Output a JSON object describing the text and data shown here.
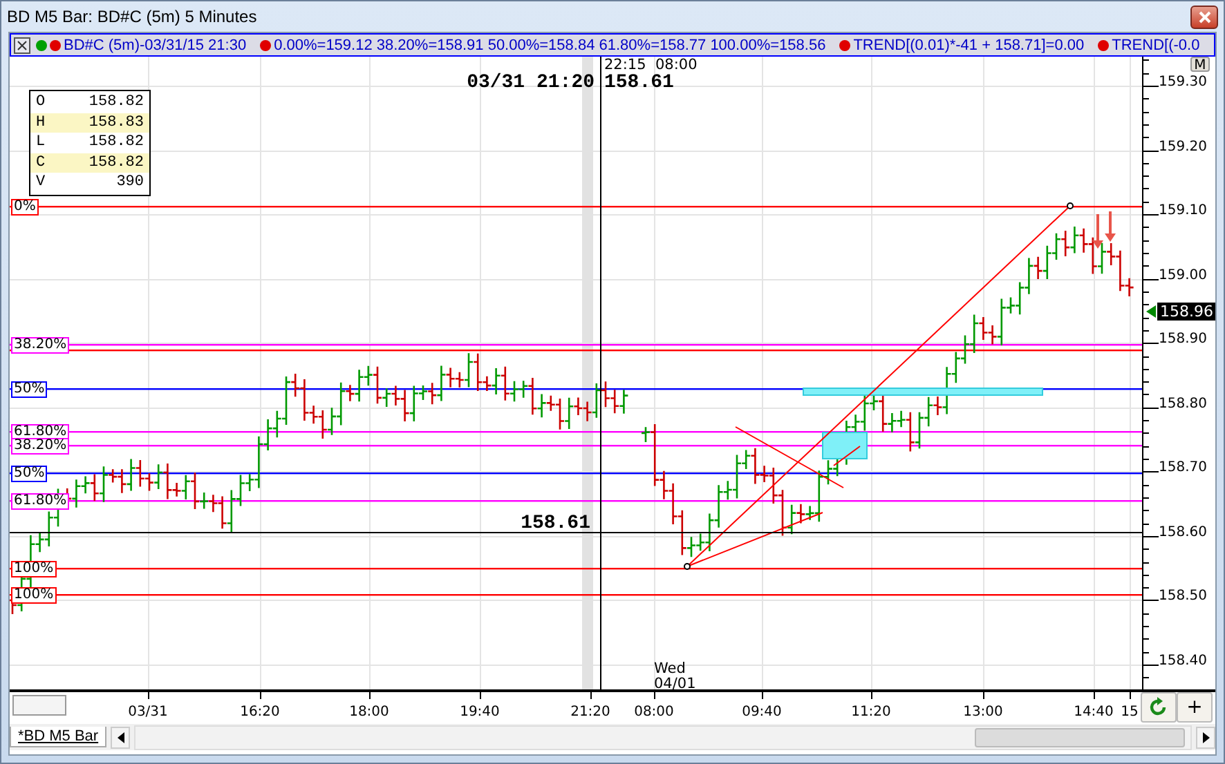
{
  "window": {
    "title": "BD M5 Bar: BD#C (5m) 5 Minutes"
  },
  "legend": {
    "items": [
      {
        "text": "BD#C (5m)-03/31/15 21:30",
        "dots": [
          {
            "color": "#00a000"
          },
          {
            "color": "#e00000"
          }
        ]
      },
      {
        "text": "0.00%=159.12 38.20%=158.91 50.00%=158.84 61.80%=158.77 100.00%=158.56",
        "dots": [
          {
            "color": "#e00000"
          }
        ]
      },
      {
        "text": "TREND[(0.01)*-41 + 158.71]=0.00",
        "dots": [
          {
            "color": "#e00000"
          }
        ]
      },
      {
        "text": "TREND[(-0.0",
        "dots": [
          {
            "color": "#e00000"
          }
        ]
      }
    ]
  },
  "chart": {
    "ohlc": [
      {
        "label": "O",
        "value": "158.82",
        "highlighted": false
      },
      {
        "label": "H",
        "value": "158.83",
        "highlighted": true
      },
      {
        "label": "L",
        "value": "158.82",
        "highlighted": false
      },
      {
        "label": "C",
        "value": "158.82",
        "highlighted": true
      },
      {
        "label": "V",
        "value": "390",
        "highlighted": false
      }
    ],
    "crosshair": {
      "date": "03/31 21:20",
      "price": "158.61",
      "time": "22:15",
      "next_time": "08:00",
      "cursor_price": "158.61"
    },
    "day_label": {
      "weekday": "Wed",
      "date": "04/01"
    },
    "fib_levels": [
      {
        "label": "0%",
        "color": "#ff0000"
      },
      {
        "label": "38.20%",
        "color": "#ff00ff"
      },
      {
        "color": "#ff0000"
      },
      {
        "label": "50%",
        "color": "#0000ff"
      },
      {
        "label": "61.80%",
        "color": "#ff00ff"
      },
      {
        "label": "38.20%",
        "color": "#ff00ff"
      },
      {
        "label": "50%",
        "color": "#0000ff"
      },
      {
        "label": "61.80%",
        "color": "#ff00ff"
      },
      {
        "label": "100%",
        "color": "#ff0000"
      },
      {
        "label": "100%",
        "color": "#ff0000"
      }
    ]
  },
  "price_axis": {
    "button": "M",
    "ticks": [
      "159.30",
      "159.20",
      "159.10",
      "159.00",
      "158.90",
      "158.80",
      "158.70",
      "158.60",
      "158.50",
      "158.40"
    ],
    "last_price": "158.96"
  },
  "time_axis": {
    "labels": [
      "03/31",
      "16:20",
      "18:00",
      "19:40",
      "21:20",
      "08:00",
      "09:40",
      "11:20",
      "13:00",
      "14:40",
      "15"
    ],
    "buttons": [
      "+"
    ]
  },
  "tabs": [
    {
      "label": "*BD M5 Bar",
      "selected": true
    }
  ]
}
